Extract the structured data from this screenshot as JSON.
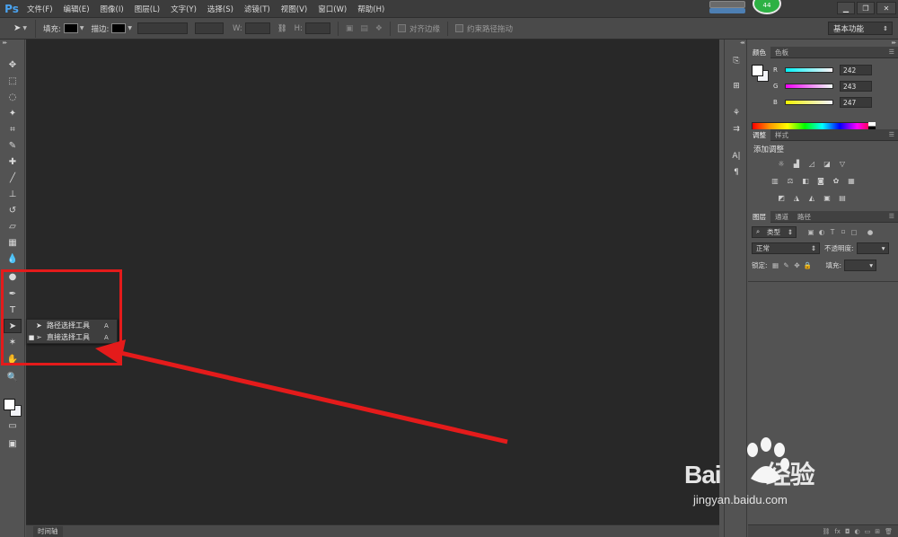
{
  "app": {
    "logo": "Ps"
  },
  "menu": [
    "文件(F)",
    "编辑(E)",
    "图像(I)",
    "图层(L)",
    "文字(Y)",
    "选择(S)",
    "滤镜(T)",
    "视图(V)",
    "窗口(W)",
    "帮助(H)"
  ],
  "badge": {
    "value": "44",
    "color": "#2db144"
  },
  "window_buttons": {
    "minimize": "▁",
    "restore": "❐",
    "close": "✕"
  },
  "options_bar": {
    "fill_label": "填充:",
    "stroke_label": "描边:",
    "w_label": "W:",
    "h_label": "H:",
    "align_edges": "对齐边缘",
    "constrain_path": "约束路径拖动",
    "workspace": "基本功能"
  },
  "flyout": {
    "items": [
      {
        "name": "路径选择工具",
        "key": "A",
        "selected": false
      },
      {
        "name": "直接选择工具",
        "key": "A",
        "selected": true
      }
    ]
  },
  "timeline_tab": "时间轴",
  "color_panel": {
    "tabs": [
      "颜色",
      "色板"
    ],
    "r": {
      "label": "R",
      "value": "242"
    },
    "g": {
      "label": "G",
      "value": "243"
    },
    "b": {
      "label": "B",
      "value": "247"
    }
  },
  "adjustments_panel": {
    "tabs": [
      "调整",
      "样式"
    ],
    "title": "添加调整"
  },
  "layers_panel": {
    "tabs": [
      "图层",
      "通道",
      "路径"
    ],
    "kind_filter": "类型",
    "blend_mode": "正常",
    "opacity_label": "不透明度:",
    "lock_label": "锁定:",
    "fill_label": "填充:"
  },
  "watermark": {
    "brand": "Bai",
    "brand2": "经验",
    "url": "jingyan.baidu.com"
  },
  "colors": {
    "accent_red": "#e41b1b",
    "ps_blue": "#4aa3f0"
  }
}
